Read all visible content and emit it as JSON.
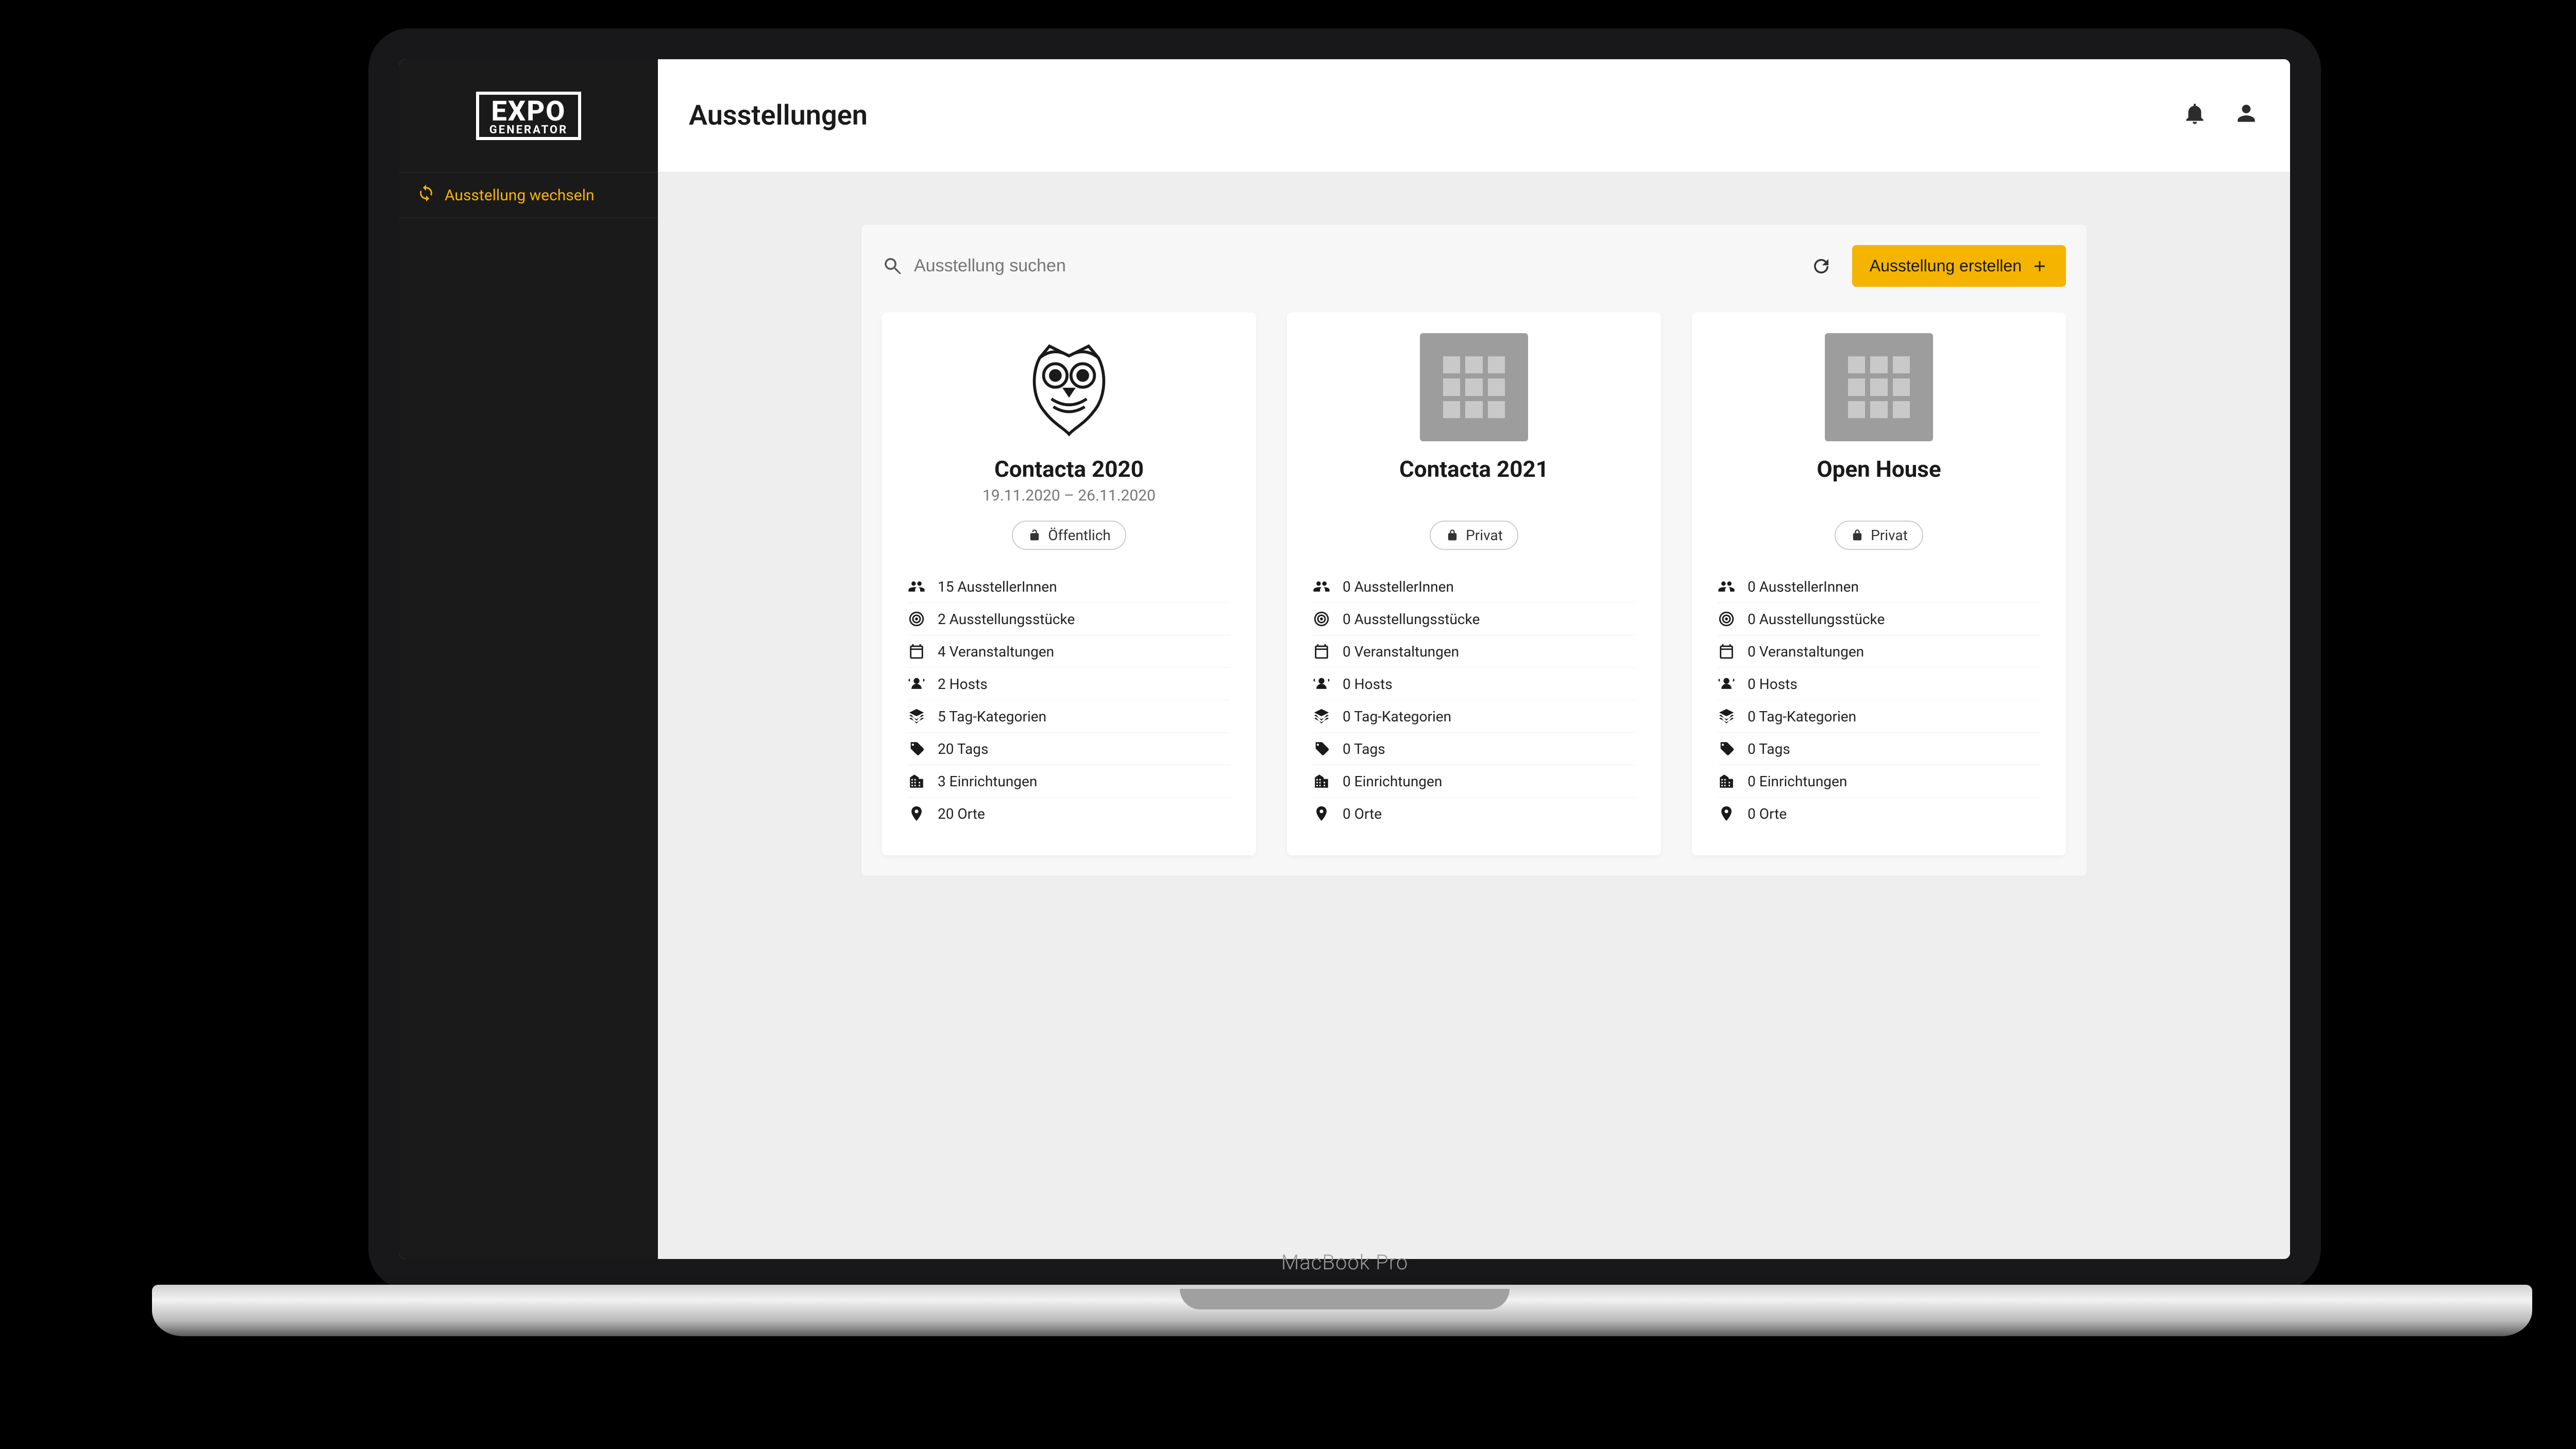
{
  "logo": {
    "top": "EXPO",
    "bottom": "GENERATOR"
  },
  "sidebar": {
    "switchLabel": "Ausstellung wechseln"
  },
  "header": {
    "title": "Ausstellungen"
  },
  "toolbar": {
    "searchPlaceholder": "Ausstellung suchen",
    "createLabel": "Ausstellung erstellen"
  },
  "device": {
    "brand": "MacBook Pro"
  },
  "cards": [
    {
      "title": "Contacta 2020",
      "dates": "19.11.2020 – 26.11.2020",
      "visibility": "Öffentlich",
      "thumb": "owl",
      "stats": {
        "exhibitors": "15 AusstellerInnen",
        "items": "2 Ausstellungsstücke",
        "events": "4 Veranstaltungen",
        "hosts": "2 Hosts",
        "tagCats": "5 Tag-Kategorien",
        "tags": "20 Tags",
        "orgs": "3 Einrichtungen",
        "places": "20 Orte"
      }
    },
    {
      "title": "Contacta 2021",
      "dates": "",
      "visibility": "Privat",
      "thumb": "placeholder",
      "stats": {
        "exhibitors": "0 AusstellerInnen",
        "items": "0 Ausstellungsstücke",
        "events": "0 Veranstaltungen",
        "hosts": "0 Hosts",
        "tagCats": "0 Tag-Kategorien",
        "tags": "0 Tags",
        "orgs": "0 Einrichtungen",
        "places": "0 Orte"
      }
    },
    {
      "title": "Open House",
      "dates": "",
      "visibility": "Privat",
      "thumb": "placeholder",
      "stats": {
        "exhibitors": "0 AusstellerInnen",
        "items": "0 Ausstellungsstücke",
        "events": "0 Veranstaltungen",
        "hosts": "0 Hosts",
        "tagCats": "0 Tag-Kategorien",
        "tags": "0 Tags",
        "orgs": "0 Einrichtungen",
        "places": "0 Orte"
      }
    }
  ]
}
